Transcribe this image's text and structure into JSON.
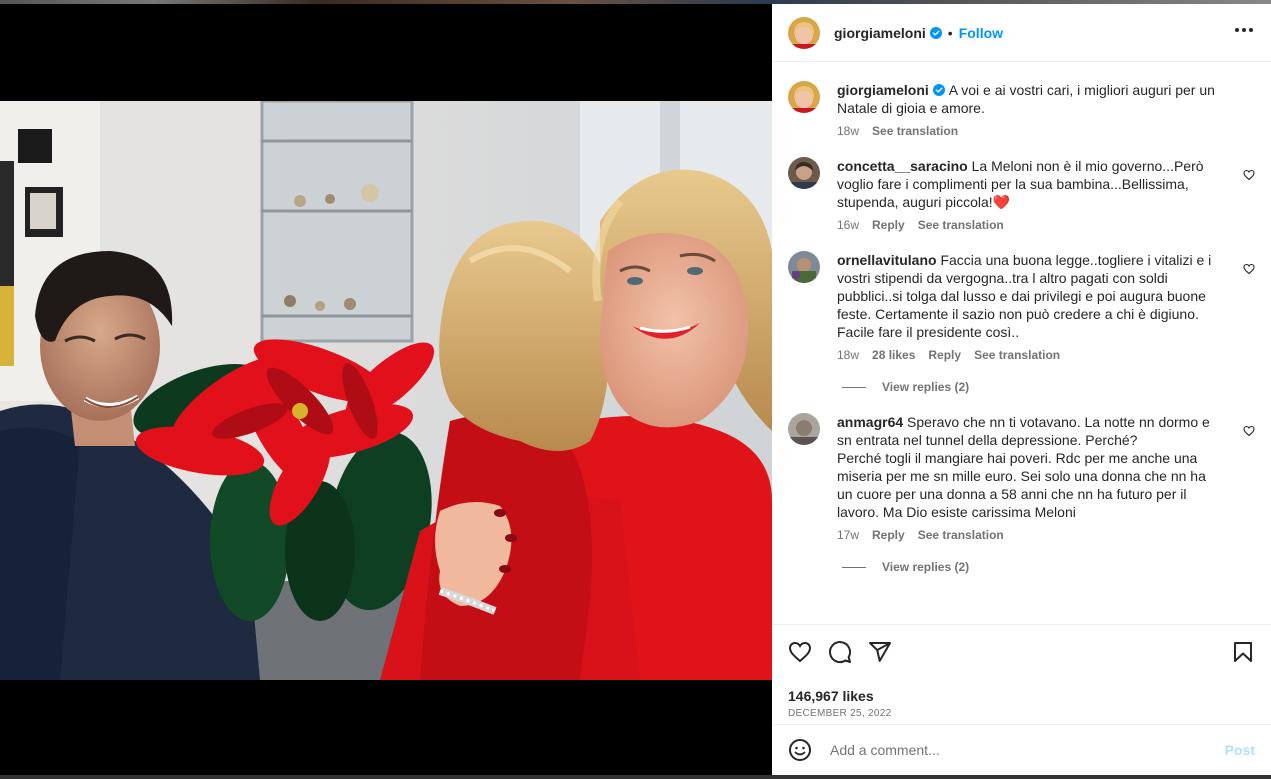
{
  "colors": {
    "accent": "#0095f6",
    "muted": "#737373",
    "text": "#262626",
    "post_disabled": "#b2dffc",
    "heart": "#ed4956"
  },
  "header": {
    "username": "giorgiameloni",
    "verified_icon": "verified-badge-icon",
    "separator": "•",
    "follow_label": "Follow",
    "more_icon": "more-options-icon"
  },
  "caption": {
    "username": "giorgiameloni",
    "text": "A voi e ai vostri cari, i migliori auguri per un Natale di gioia e amore.",
    "time": "18w",
    "see_translation": "See translation"
  },
  "comments": [
    {
      "username": "concetta__saracino",
      "text": "La Meloni non è il mio governo...Però voglio fare i complimenti per la sua bambina...Bellissima, stupenda, auguri piccola!❤️",
      "time": "16w",
      "reply": "Reply",
      "see_translation": "See translation"
    },
    {
      "username": "ornellavitulano",
      "text": "Faccia una buona legge..togliere i vitalizi e i vostri stipendi da vergogna..tra l altro pagati con soldi pubblici..si tolga dal lusso e dai privilegi e poi augura buone feste. Certamente il sazio non può credere a chi è digiuno. Facile fare il presidente così..",
      "time": "18w",
      "likes": "28 likes",
      "reply": "Reply",
      "see_translation": "See translation",
      "view_replies": "View replies (2)"
    },
    {
      "username": "anmagr64",
      "text": "Speravo che nn ti votavano. La notte nn dormo e sn entrata nel tunnel della depressione. Perché?\nPerché togli il mangiare hai poveri. Rdc per me anche una miseria per me sn mille euro. Sei solo una donna che nn ha un cuore per una donna a 58 anni che nn ha futuro per il lavoro. Ma Dio esiste carissima Meloni",
      "time": "17w",
      "reply": "Reply",
      "see_translation": "See translation",
      "view_replies": "View replies (2)"
    }
  ],
  "actions": {
    "icons": [
      "heart-icon",
      "comment-icon",
      "share-icon",
      "bookmark-icon"
    ],
    "likes": "146,967 likes",
    "date": "DECEMBER 25, 2022"
  },
  "add_comment": {
    "emoji_icon": "emoji-icon",
    "placeholder": "Add a comment...",
    "post_label": "Post"
  }
}
